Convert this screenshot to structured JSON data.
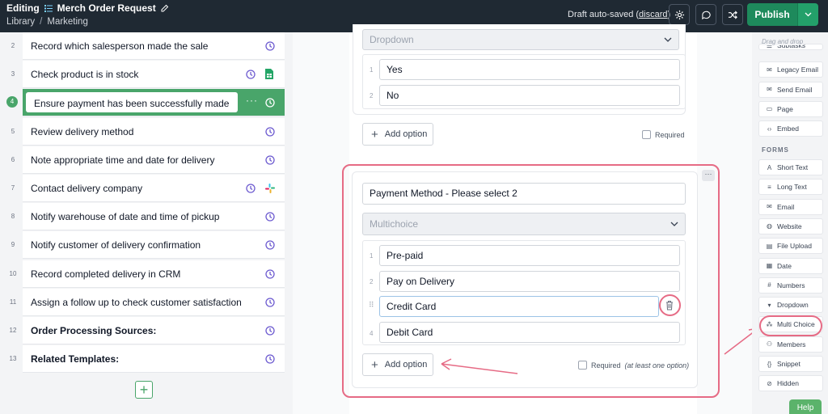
{
  "header": {
    "mode_label": "Editing",
    "doc_title": "Merch Order Request",
    "breadcrumb": [
      "Library",
      "Marketing"
    ],
    "draft_text": "Draft auto-saved (",
    "discard_label": "discard",
    "draft_suffix": ")",
    "publish_label": "Publish"
  },
  "steps": [
    {
      "num": "2",
      "label": "Record which salesperson made the sale",
      "bold": false
    },
    {
      "num": "3",
      "label": "Check product is in stock",
      "bold": false,
      "extra_icon": "sheets-icon"
    },
    {
      "num": "4",
      "label": "Ensure payment has been successfully made",
      "bold": false,
      "active": true
    },
    {
      "num": "5",
      "label": "Review delivery method",
      "bold": false
    },
    {
      "num": "6",
      "label": "Note appropriate time and date for delivery",
      "bold": false
    },
    {
      "num": "7",
      "label": "Contact delivery company",
      "bold": false,
      "extra_icon": "slack-icon"
    },
    {
      "num": "8",
      "label": "Notify warehouse of date and time of pickup",
      "bold": false
    },
    {
      "num": "9",
      "label": "Notify customer of delivery confirmation",
      "bold": false
    },
    {
      "num": "10",
      "label": "Record completed delivery in CRM",
      "bold": false
    },
    {
      "num": "11",
      "label": "Assign a follow up to check customer satisfaction",
      "bold": false
    },
    {
      "num": "12",
      "label": "Order Processing Sources:",
      "bold": true
    },
    {
      "num": "13",
      "label": "Related Templates:",
      "bold": true
    }
  ],
  "dropdown_block": {
    "select_label": "Dropdown",
    "options": [
      {
        "num": "1",
        "value": "Yes"
      },
      {
        "num": "2",
        "value": "No"
      }
    ],
    "add_option_label": "Add option",
    "required_label": "Required"
  },
  "multichoice_block": {
    "question": "Payment Method - Please select 2",
    "select_label": "Multichoice",
    "options": [
      {
        "num": "1",
        "value": "Pre-paid"
      },
      {
        "num": "2",
        "value": "Pay on Delivery"
      },
      {
        "num": "",
        "value": "Credit Card"
      },
      {
        "num": "4",
        "value": "Debit Card"
      }
    ],
    "add_option_label": "Add option",
    "required_label": "Required",
    "required_hint": "(at least one option)"
  },
  "sidebar": {
    "drag_hint": "Drag and drop",
    "top_items": [
      {
        "label": "Subtasks",
        "icon": "subtasks-icon"
      },
      {
        "label": "Legacy Email",
        "icon": "legacy-email-icon"
      },
      {
        "label": "Send Email",
        "icon": "send-email-icon"
      },
      {
        "label": "Page",
        "icon": "page-icon"
      },
      {
        "label": "Embed",
        "icon": "embed-icon"
      }
    ],
    "forms_header": "FORMS",
    "form_items": [
      {
        "label": "Short Text",
        "icon": "short-text-icon"
      },
      {
        "label": "Long Text",
        "icon": "long-text-icon"
      },
      {
        "label": "Email",
        "icon": "email-icon"
      },
      {
        "label": "Website",
        "icon": "website-icon"
      },
      {
        "label": "File Upload",
        "icon": "file-upload-icon"
      },
      {
        "label": "Date",
        "icon": "date-icon"
      },
      {
        "label": "Numbers",
        "icon": "numbers-icon"
      },
      {
        "label": "Dropdown",
        "icon": "dropdown-icon"
      },
      {
        "label": "Multi Choice",
        "icon": "multi-choice-icon"
      },
      {
        "label": "Members",
        "icon": "members-icon"
      },
      {
        "label": "Snippet",
        "icon": "snippet-icon"
      },
      {
        "label": "Hidden",
        "icon": "hidden-icon"
      }
    ],
    "help_label": "Help"
  },
  "colors": {
    "topbar": "#1f2933",
    "publish": "#1e8a5c",
    "active_step": "#49a56a",
    "annotation": "#e66b85",
    "clock_icon": "#6d5bd0"
  }
}
